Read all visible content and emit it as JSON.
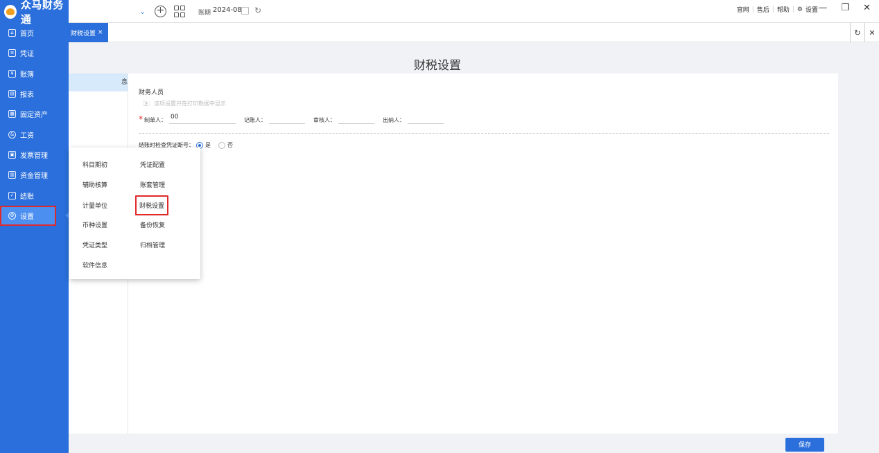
{
  "app": {
    "title": "众马财务通"
  },
  "sidebar": {
    "items": [
      {
        "label": "首页",
        "icon": "home-icon"
      },
      {
        "label": "凭证",
        "icon": "voucher-icon"
      },
      {
        "label": "账簿",
        "icon": "ledger-icon"
      },
      {
        "label": "报表",
        "icon": "report-icon"
      },
      {
        "label": "固定资产",
        "icon": "asset-icon"
      },
      {
        "label": "工资",
        "icon": "salary-icon"
      },
      {
        "label": "发票管理",
        "icon": "invoice-icon"
      },
      {
        "label": "资金管理",
        "icon": "fund-icon"
      },
      {
        "label": "结账",
        "icon": "closing-icon"
      },
      {
        "label": "设置",
        "icon": "gear-icon"
      }
    ]
  },
  "topbar": {
    "period_label": "账期",
    "period_value": "2024-08",
    "links": [
      "官网",
      "售后",
      "帮助",
      "设置"
    ]
  },
  "tabs": {
    "active_label": "财税设置",
    "close": "×"
  },
  "page": {
    "title": "财税设置",
    "left_panel_text": "息",
    "section_title": "财务人员",
    "note": "注：该项设置只在打印数据中显示",
    "fields": {
      "maker_label": "制单人：",
      "maker_value": "00",
      "bookkeeper_label": "记账人：",
      "auditor_label": "审核人：",
      "cashier_label": "出纳人："
    },
    "check_label": "结账时检查凭证断号：",
    "yes": "是",
    "no": "否",
    "save_label": "保存"
  },
  "popup": {
    "col1": [
      "科目期初",
      "辅助核算",
      "计量单位",
      "币种设置",
      "凭证类型",
      "软件信息"
    ],
    "col2": [
      "凭证配置",
      "账套管理",
      "财税设置",
      "备份恢复",
      "归档管理"
    ]
  }
}
